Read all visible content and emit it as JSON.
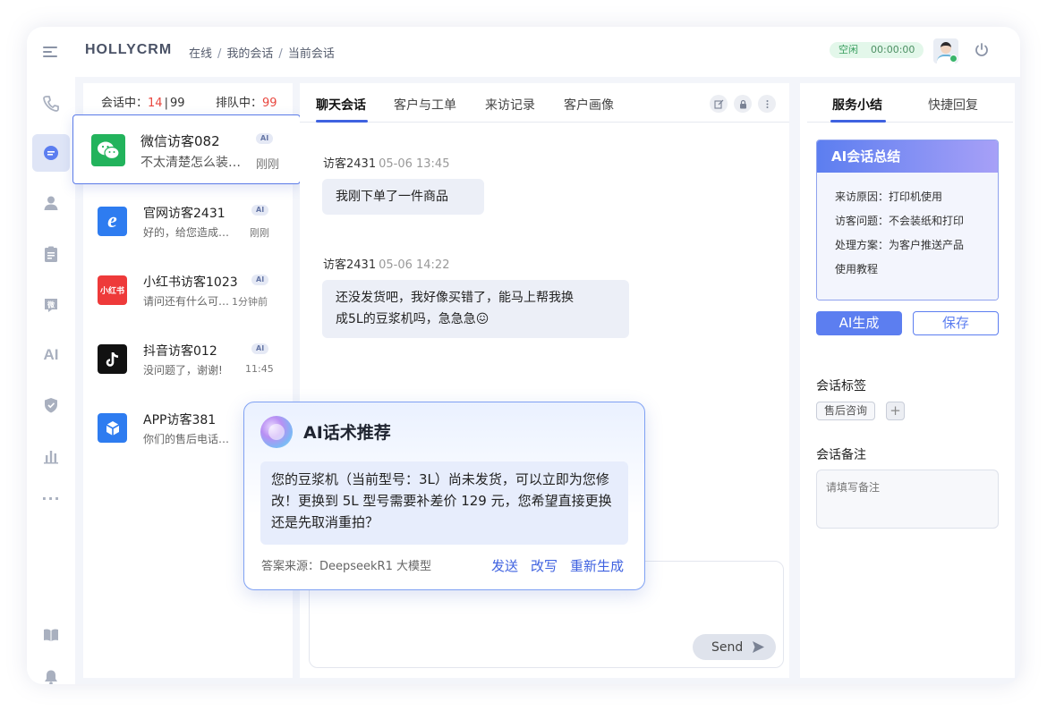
{
  "header": {
    "brand": "HOLLYCRM",
    "breadcrumb": [
      "在线",
      "我的会话",
      "当前会话"
    ],
    "status": "空闲",
    "status_time": "00:00:00"
  },
  "rail": {
    "icons": [
      "phone-icon",
      "chat-icon",
      "user-icon",
      "clipboard-icon",
      "wechat-service-icon",
      "ai-icon",
      "shield-icon",
      "bar-chart-icon",
      "more-icon",
      "book-icon",
      "bell-icon"
    ],
    "ai_label": "AI",
    "more_label": "..."
  },
  "sessions": {
    "active_label": "会话中：",
    "active_count": "14",
    "active_total": "99",
    "queue_label": "排队中：",
    "queue_count": "99",
    "items": [
      {
        "name": "微信访客082",
        "msg": "不太清楚怎么装…",
        "time": "刚刚",
        "tag": "AI",
        "channel": "wechat"
      },
      {
        "name": "官网访客2431",
        "msg": "好的，给您造成…",
        "time": "刚刚",
        "tag": "AI",
        "channel": "ie"
      },
      {
        "name": "小红书访客1023",
        "msg": "请问还有什么可…",
        "time": "1分钟前",
        "tag": "AI",
        "channel": "xiaohongshu",
        "logo_text": "小红书"
      },
      {
        "name": "抖音访客012",
        "msg": "没问题了，谢谢!",
        "time": "11:45",
        "tag": "AI",
        "channel": "douyin"
      },
      {
        "name": "APP访客381",
        "msg": "你们的售后电话…",
        "time": "",
        "tag": "",
        "channel": "app"
      }
    ]
  },
  "chat": {
    "tabs": [
      "聊天会话",
      "客户与工单",
      "来访记录",
      "客户画像"
    ],
    "messages": [
      {
        "sender": "访客2431",
        "time": "05-06 13:45",
        "text": "我刚下单了一件商品"
      },
      {
        "sender": "访客2431",
        "time": "05-06 14:22",
        "text_line1": "还没发货吧，我好像买错了，能马上帮我换",
        "text_line2": "成5L的豆浆机吗，急急急😖"
      }
    ],
    "send_label": "Send"
  },
  "right": {
    "tabs": [
      "服务小结",
      "快捷回复"
    ],
    "summary_title": "AI会话总结",
    "summary_lines": [
      "来访原因：打印机使用",
      "访客问题：不会装纸和打印",
      "处理方案：为客户推送产品",
      "使用教程"
    ],
    "btn_ai": "AI生成",
    "btn_save": "保存",
    "tags_label": "会话标签",
    "tag": "售后咨询",
    "tag_add": "+",
    "remark_label": "会话备注",
    "remark_placeholder": "请填写备注"
  },
  "popup": {
    "title": "AI话术推荐",
    "body": "您的豆浆机（当前型号：3L）尚未发货，可以立即为您修改！更换到 5L 型号需要补差价 129 元，您希望直接更换还是先取消重拍？",
    "source": "答案来源：DeepseekR1 大模型",
    "actions": [
      "发送",
      "改写",
      "重新生成"
    ]
  }
}
